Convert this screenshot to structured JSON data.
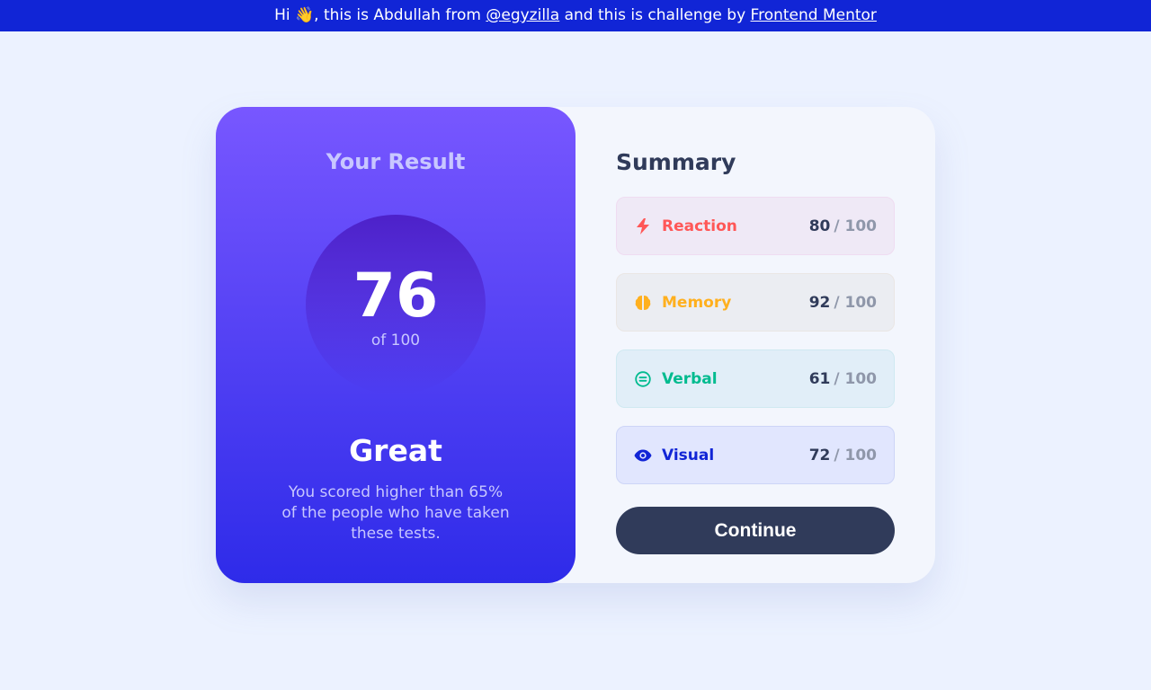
{
  "banner": {
    "prefix": "Hi 👋, this is Abdullah from ",
    "author_link": "@egyzilla",
    "middle": " and this is challenge by ",
    "challenge_link": "Frontend Mentor"
  },
  "result": {
    "title": "Your Result",
    "score": "76",
    "of_label": "of 100",
    "verdict": "Great",
    "description": "You scored higher than 65% of the people who have taken these tests."
  },
  "summary": {
    "title": "Summary",
    "items": [
      {
        "label": "Reactio­n",
        "score": "80",
        "max": "/ 100",
        "icon": "lightning-icon",
        "color": "#ff5757",
        "bg": "#efe9f6",
        "border": "#efdcf1"
      },
      {
        "label": "Memory",
        "score": "92",
        "max": "/ 100",
        "icon": "brain-icon",
        "color": "#ffb01f",
        "bg": "#ebedf2",
        "border": "#eae6e4"
      },
      {
        "label": "Verbal",
        "score": "61",
        "max": "/ 100",
        "icon": "equals-circle-icon",
        "color": "#00bb8f",
        "bg": "#e1eef8",
        "border": "#cfe9f1"
      },
      {
        "label": "Visual",
        "score": "72",
        "max": "/ 100",
        "icon": "eye-icon",
        "color": "#1125d6",
        "bg": "#e1e6fe",
        "border": "#cdd5f7"
      }
    ],
    "continue_label": "Continue"
  },
  "colors": {
    "banner": "#1125d6",
    "page_bg": "#ecf2ff",
    "gradient_top": "#7857ff",
    "gradient_bottom": "#2e2be9",
    "dark_navy": "#303b5a"
  }
}
